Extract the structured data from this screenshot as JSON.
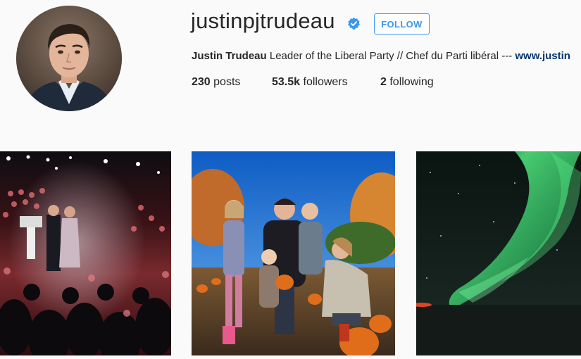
{
  "profile": {
    "username": "justinpjtrudeau",
    "follow_label": "FOLLOW",
    "full_name": "Justin Trudeau",
    "bio": " Leader of the Liberal Party // Chef du Parti libéral --- ",
    "bio_link": "www.justin",
    "avatar_icon": "profile-photo-icon",
    "verified_icon": "verified-badge-icon",
    "accent_color": "#3897f0"
  },
  "stats": {
    "posts_count": "230",
    "posts_label": " posts",
    "followers_count": "53.5k",
    "followers_label": " followers",
    "following_count": "2",
    "following_label": " following"
  },
  "posts": [
    {
      "icon": "rally-crowd-photo"
    },
    {
      "icon": "family-pumpkin-patch-photo"
    },
    {
      "icon": "northern-lights-photo"
    }
  ]
}
